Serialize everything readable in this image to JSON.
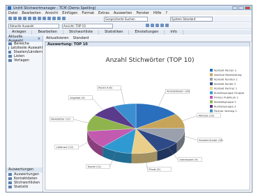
{
  "window": {
    "title": "Unit4 Stichwortmanager - TCM (Demo Spelling)"
  },
  "menu": [
    "Datei",
    "Bearbeiten",
    "Ansicht",
    "Einfügen",
    "Format",
    "Extras",
    "Auswerten",
    "Fenster",
    "Hilfe",
    "?"
  ],
  "toolbar": {
    "filter_combo": "Gespeicherte Suchen",
    "domain_combo": "System Standard"
  },
  "toolbar2": {
    "path_combo": "Aktuelle Auswahl",
    "view_combo": "Ansicht: TOP 10"
  },
  "tabs": [
    "Anlegen",
    "Bearbeiten",
    "Stichwortliste",
    "Statistiken",
    "Einstellungen",
    "Info"
  ],
  "nav": {
    "header": "Aktuelle Auswahl",
    "items": [
      "Bereiche",
      "Letzteste Auswahl",
      "Staaten/Ländern",
      "Listen",
      "Vorlagen"
    ],
    "group": "Auswertungen",
    "group_items": [
      "Auswertungen",
      "Kontaktdaten",
      "Stichwortlisten",
      "Statistik"
    ]
  },
  "main": {
    "toolbar_label": "Aktualisieren",
    "toolbar_dropdown": "Standard",
    "panel_title": "Auswertung: TOP 10"
  },
  "chart_data": {
    "type": "pie",
    "title": "Anzahl Stichwörter (TOP 10)",
    "categories": [
      "Kontaktdaten",
      "Adresse",
      "Kontakt Kunde",
      "Interessent",
      "Privat",
      "Kunde",
      "Lieferant",
      "Newsletter",
      "Angebot",
      "Rückruf"
    ],
    "values": [
      16,
      10,
      10,
      9,
      9,
      11,
      12,
      11,
      9,
      8
    ],
    "colors": [
      "#2a6fbd",
      "#c6a45a",
      "#9aa1ad",
      "#2e4a86",
      "#e9cf8a",
      "#2f9ad1",
      "#c25ab0",
      "#8fb44e",
      "#5a3a8a",
      "#3b8fd0"
    ],
    "legend": [
      "Kontakt Person 1",
      "Adresse Bearbeitung",
      "Kontakt Kunden 1",
      "Kontakt Kunde 2",
      "Kontakt Partner 1",
      "Kundengruppe Gruppe",
      "Firmen Publikum 1",
      "Kontaktgruppe 2",
      "Kundengruppe 3",
      "Partner Vertrag 1"
    ],
    "legend_placement": "right"
  }
}
